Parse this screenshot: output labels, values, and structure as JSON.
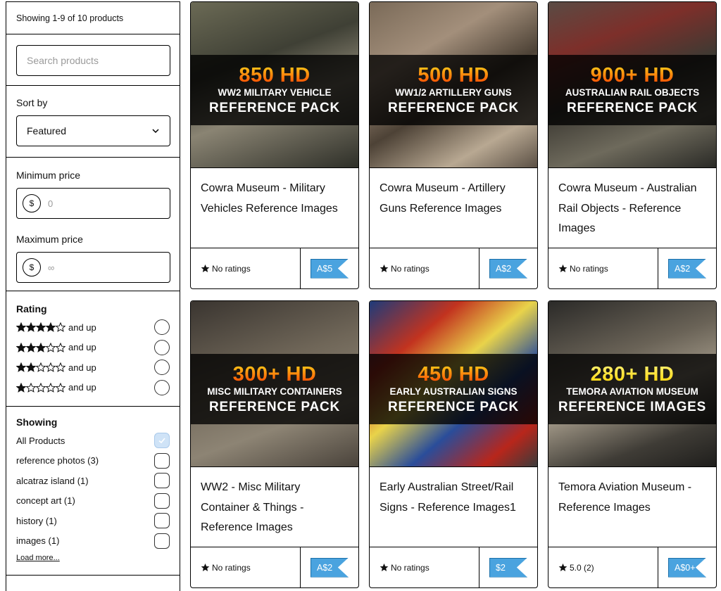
{
  "sidebar": {
    "count_text": "Showing 1-9 of 10 products",
    "search_placeholder": "Search products",
    "sort_label": "Sort by",
    "sort_value": "Featured",
    "min_price_label": "Minimum price",
    "min_price_placeholder": "0",
    "max_price_label": "Maximum price",
    "max_price_placeholder": "∞",
    "currency_symbol": "$",
    "rating_title": "Rating",
    "rating_options": [
      {
        "stars": 4,
        "label": "and up"
      },
      {
        "stars": 3,
        "label": "and up"
      },
      {
        "stars": 2,
        "label": "and up"
      },
      {
        "stars": 1,
        "label": "and up"
      }
    ],
    "showing_title": "Showing",
    "showing_options": [
      {
        "label": "All Products",
        "checked": true
      },
      {
        "label": "reference photos (3)",
        "checked": false
      },
      {
        "label": "alcatraz island (1)",
        "checked": false
      },
      {
        "label": "concept art (1)",
        "checked": false
      },
      {
        "label": "history (1)",
        "checked": false
      },
      {
        "label": "images (1)",
        "checked": false
      }
    ],
    "load_more": "Load more..."
  },
  "products": [
    {
      "big": "850 HD",
      "sub": "WW2 MILITARY VEHICLE",
      "pack": "REFERENCE PACK",
      "title": "Cowra Museum - Military Vehicles Reference Images",
      "rating": "No ratings",
      "price": "A$5",
      "big_style": "fire"
    },
    {
      "big": "500 HD",
      "sub": "WW1/2 ARTILLERY GUNS",
      "pack": "REFERENCE PACK",
      "title": "Cowra Museum - Artillery Guns Reference Images",
      "rating": "No ratings",
      "price": "A$2",
      "big_style": "fire"
    },
    {
      "big": "900+ HD",
      "sub": "AUSTRALIAN RAIL OBJECTS",
      "pack": "REFERENCE PACK",
      "title": "Cowra Museum - Australian Rail Objects - Reference Images",
      "rating": "No ratings",
      "price": "A$2",
      "big_style": "fire"
    },
    {
      "big": "300+ HD",
      "sub": "MISC MILITARY CONTAINERS",
      "pack": "REFERENCE PACK",
      "title": "WW2 - Misc Military Container & Things - Reference Images",
      "rating": "No ratings",
      "price": "A$2",
      "big_style": "fire"
    },
    {
      "big": "450 HD",
      "sub": "EARLY AUSTRALIAN SIGNS",
      "pack": "REFERENCE PACK",
      "title": "Early Australian Street/Rail Signs - Reference Images1",
      "rating": "No ratings",
      "price": "$2",
      "big_style": "fire"
    },
    {
      "big": "280+ HD",
      "sub": "TEMORA AVIATION MUSEUM",
      "pack": "REFERENCE IMAGES",
      "title": "Temora Aviation Museum - Reference Images",
      "rating": "5.0 (2)",
      "price": "A$0+",
      "big_style": "yellow"
    }
  ],
  "colors": {
    "price_tag": "#4aa3df",
    "checkbox_checked": "#cfe3f7"
  }
}
